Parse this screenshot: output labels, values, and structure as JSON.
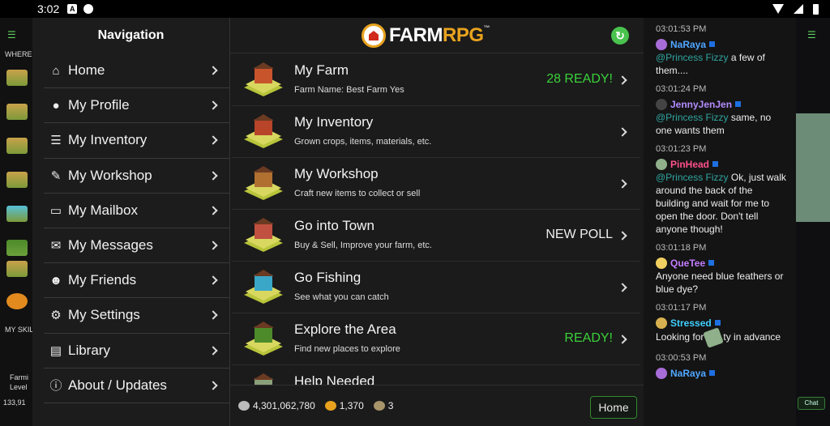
{
  "status_bar": {
    "time": "3:02",
    "notification_a": "A"
  },
  "background": {
    "where_label": "WHERE I",
    "skills_label": "MY SKIL",
    "farming_label": "Farmi",
    "level_label": "Level",
    "silver_partial": "133,91",
    "chat_button": "Chat"
  },
  "navigation": {
    "title": "Navigation",
    "items": [
      {
        "label": "Home",
        "icon": "home-icon",
        "glyph": "⌂"
      },
      {
        "label": "My Profile",
        "icon": "user-icon",
        "glyph": "●"
      },
      {
        "label": "My Inventory",
        "icon": "list-icon",
        "glyph": "☰"
      },
      {
        "label": "My Workshop",
        "icon": "wrench-icon",
        "glyph": "✎"
      },
      {
        "label": "My Mailbox",
        "icon": "inbox-icon",
        "glyph": "▭"
      },
      {
        "label": "My Messages",
        "icon": "envelope-icon",
        "glyph": "✉"
      },
      {
        "label": "My Friends",
        "icon": "users-icon",
        "glyph": "☻"
      },
      {
        "label": "My Settings",
        "icon": "gear-icon",
        "glyph": "⚙"
      },
      {
        "label": "Library",
        "icon": "book-icon",
        "glyph": "▤"
      },
      {
        "label": "About / Updates",
        "icon": "info-icon",
        "glyph": "ⓘ"
      }
    ]
  },
  "header": {
    "logo_word_white": "FARM",
    "logo_word_orange": "RPG",
    "logo_tm": "™"
  },
  "main": {
    "rows": [
      {
        "title": "My Farm",
        "subtitle": "Farm Name: Best Farm Yes",
        "badge": "28 READY!",
        "badge_color": "green",
        "img_color": "#c8542c"
      },
      {
        "title": "My Inventory",
        "subtitle": "Grown crops, items, materials, etc.",
        "badge": "",
        "badge_color": "",
        "img_color": "#b8452a"
      },
      {
        "title": "My Workshop",
        "subtitle": "Craft new items to collect or sell",
        "badge": "",
        "badge_color": "",
        "img_color": "#b07030"
      },
      {
        "title": "Go into Town",
        "subtitle": "Buy & Sell, Improve your farm, etc.",
        "badge": "NEW POLL",
        "badge_color": "white",
        "img_color": "#c05040"
      },
      {
        "title": "Go Fishing",
        "subtitle": "See what you can catch",
        "badge": "",
        "badge_color": "",
        "img_color": "#3aa7c8"
      },
      {
        "title": "Explore the Area",
        "subtitle": "Find new places to explore",
        "badge": "READY!",
        "badge_color": "green",
        "img_color": "#4c8a2a"
      },
      {
        "title": "Help Needed",
        "subtitle": "",
        "badge": "",
        "badge_color": "",
        "img_color": "#8aa07a"
      }
    ]
  },
  "resources": {
    "silver": "4,301,062,780",
    "gold": "1,370",
    "ancient_coins": "3"
  },
  "footer": {
    "home_button": "Home"
  },
  "chat": {
    "messages": [
      {
        "time": "03:01:53 PM",
        "user": "NaRaya",
        "user_color": "#4fa6ff",
        "avatar_color": "#a86cd8",
        "mention": "",
        "text": "@Princess Fizzy a few of them...."
      },
      {
        "time": "03:01:24 PM",
        "user": "JennyJenJen",
        "user_color": "#b48cff",
        "avatar_color": "#444444",
        "mention": "@Princess Fizzy",
        "text": " same, no one wants them"
      },
      {
        "time": "03:01:23 PM",
        "user": "PinHead",
        "user_color": "#ff4f8b",
        "avatar_color": "#8fb08a",
        "mention": "@Princess Fizzy",
        "text": " Ok, just walk around the back of the building and wait for me to open the door. Don't tell anyone though!"
      },
      {
        "time": "03:01:18 PM",
        "user": "QueTee",
        "user_color": "#c47cff",
        "avatar_color": "#f0d060",
        "mention": "",
        "text": "Anyone need blue feathers or blue dye?"
      },
      {
        "time": "03:01:17 PM",
        "user": "Stressed",
        "user_color": "#3fd0ff",
        "avatar_color": "#d8b050",
        "mention": "",
        "text_before": "Looking for",
        "text_after": "ty in advance"
      },
      {
        "time": "03:00:53 PM",
        "user": "NaRaya",
        "user_color": "#4fa6ff",
        "avatar_color": "#a86cd8",
        "mention": "",
        "text": ""
      }
    ]
  }
}
